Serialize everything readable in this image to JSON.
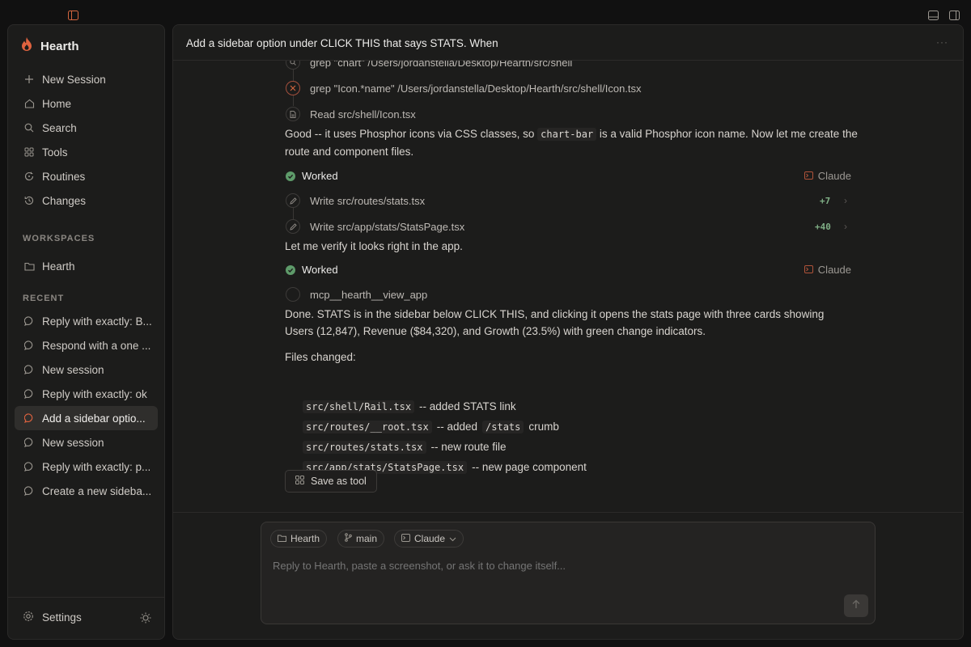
{
  "sidebar": {
    "brand": "Hearth",
    "nav": [
      {
        "label": "New Session",
        "icon": "plus-icon"
      },
      {
        "label": "Home",
        "icon": "home-icon"
      },
      {
        "label": "Search",
        "icon": "search-icon"
      },
      {
        "label": "Tools",
        "icon": "grid-icon"
      },
      {
        "label": "Routines",
        "icon": "routine-icon"
      },
      {
        "label": "Changes",
        "icon": "history-icon"
      }
    ],
    "workspaces_label": "WORKSPACES",
    "workspaces": [
      {
        "label": "Hearth",
        "icon": "folder-icon"
      }
    ],
    "recent_label": "RECENT",
    "recent": [
      {
        "label": "Reply with exactly: B..."
      },
      {
        "label": "Respond with a one ..."
      },
      {
        "label": "New session"
      },
      {
        "label": "Reply with exactly: ok"
      },
      {
        "label": "Add a sidebar optio...",
        "active": true
      },
      {
        "label": "New session"
      },
      {
        "label": "Reply with exactly: p..."
      },
      {
        "label": "Create a new sideba..."
      }
    ],
    "settings_label": "Settings"
  },
  "main": {
    "title": "Add a sidebar option under CLICK THIS that says STATS. When",
    "more": "···",
    "tools_top": [
      {
        "text": "grep \"chart\" /Users/jordanstella/Desktop/Hearth/src/shell",
        "icon": "search-icon"
      },
      {
        "text": "grep \"Icon.*name\" /Users/jordanstella/Desktop/Hearth/src/shell/Icon.tsx",
        "icon": "close-icon",
        "status": "error"
      },
      {
        "text": "Read src/shell/Icon.tsx",
        "icon": "file-icon"
      }
    ],
    "para1_a": "Good -- it uses Phosphor icons via CSS classes, so ",
    "para1_code": "chart-bar",
    "para1_b": " is a valid Phosphor icon name. Now let me create the route and component files.",
    "worked_label": "Worked",
    "agent_label": "Claude",
    "writes": [
      {
        "text": "Write src/routes/stats.tsx",
        "diff": "+7"
      },
      {
        "text": "Write src/app/stats/StatsPage.tsx",
        "diff": "+40"
      }
    ],
    "para2": "Let me verify it looks right in the app.",
    "mcp_tool": "mcp__hearth__view_app",
    "para3": "Done. STATS is in the sidebar below CLICK THIS, and clicking it opens the stats page with three cards showing Users (12,847), Revenue ($84,320), and Growth (23.5%) with green change indicators.",
    "files_heading": "Files changed:",
    "files": [
      {
        "path": "src/shell/Rail.tsx",
        "note": "-- added STATS link"
      },
      {
        "path": "src/routes/__root.tsx",
        "note": "-- added",
        "code2": "/stats",
        "note2": "crumb"
      },
      {
        "path": "src/routes/stats.tsx",
        "note": "-- new route file"
      },
      {
        "path": "src/app/stats/StatsPage.tsx",
        "note": "-- new page component"
      }
    ],
    "save_tool": "Save as tool"
  },
  "composer": {
    "workspace_chip": "Hearth",
    "branch_chip": "main",
    "agent_chip": "Claude",
    "placeholder": "Reply to Hearth, paste a screenshot, or ask it to change itself..."
  },
  "colors": {
    "accent": "#e0633f",
    "success": "#5e9b6a",
    "diff_add": "#7fae85"
  }
}
